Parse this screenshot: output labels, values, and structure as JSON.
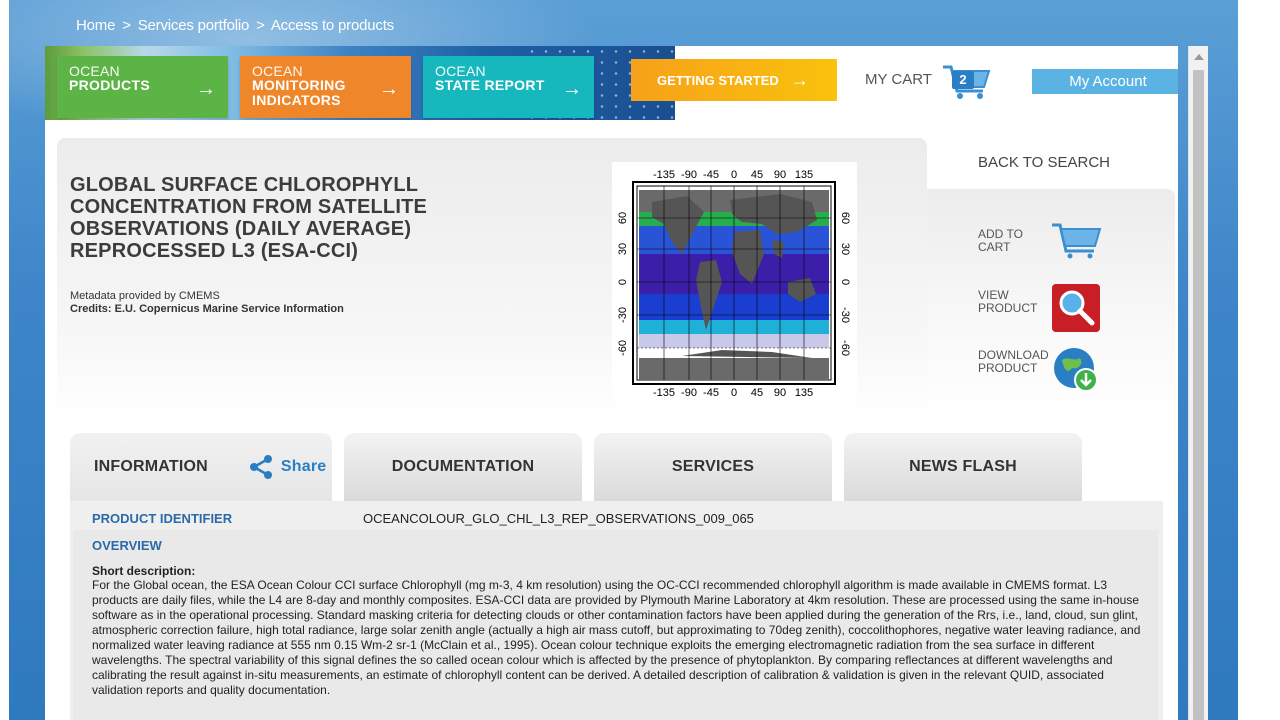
{
  "breadcrumb": {
    "home": "Home",
    "services": "Services portfolio",
    "current": "Access to products",
    "separator": ">"
  },
  "nav": {
    "products": {
      "line1": "OCEAN",
      "line2": "PRODUCTS",
      "arrow": "→"
    },
    "monitoring": {
      "line1": "OCEAN",
      "line2": "MONITORING",
      "line3": "INDICATORS",
      "arrow": "→"
    },
    "state": {
      "line1": "OCEAN",
      "line2": "STATE REPORT",
      "arrow": "→"
    },
    "getting_started": "GETTING STARTED",
    "getting_started_arrow": "→",
    "my_cart": "MY CART",
    "cart_count": "2",
    "my_account": "My Account"
  },
  "product": {
    "title": "GLOBAL SURFACE CHLOROPHYLL CONCENTRATION FROM SATELLITE OBSERVATIONS (DAILY AVERAGE) REPROCESSED L3 (ESA-CCI)",
    "metadata": "Metadata provided by CMEMS",
    "credits": "Credits: E.U. Copernicus Marine Service Information"
  },
  "map": {
    "top_ticks": [
      "-135",
      "-90",
      "-45",
      "0",
      "45",
      "90",
      "135"
    ],
    "bottom_ticks": [
      "-135",
      "-90",
      "-45",
      "0",
      "45",
      "90",
      "135"
    ],
    "left_ticks": [
      "60",
      "30",
      "0",
      "-30",
      "-60"
    ],
    "right_ticks": [
      "60",
      "30",
      "0",
      "-30",
      "-60"
    ]
  },
  "side": {
    "back_to_search": "BACK TO SEARCH",
    "add_to_cart": [
      "ADD TO",
      "CART"
    ],
    "view_product": [
      "VIEW",
      "PRODUCT"
    ],
    "download_product": [
      "DOWNLOAD",
      "PRODUCT"
    ]
  },
  "tabs": {
    "information": "INFORMATION",
    "share": "Share",
    "documentation": "DOCUMENTATION",
    "services": "SERVICES",
    "news_flash": "NEWS FLASH"
  },
  "info": {
    "product_identifier_label": "PRODUCT IDENTIFIER",
    "product_identifier_value": "OCEANCOLOUR_GLO_CHL_L3_REP_OBSERVATIONS_009_065",
    "overview_label": "OVERVIEW",
    "short_description_label": "Short description:",
    "short_description": "For the Global ocean, the ESA Ocean Colour CCI surface Chlorophyll (mg m-3, 4 km resolution) using the OC-CCI recommended chlorophyll algorithm is made available in CMEMS format. L3 products are daily files, while the L4 are 8-day and monthly composites. ESA-CCI data are provided by Plymouth Marine Laboratory at 4km resolution. These are processed using the same in-house software as in the operational processing. Standard masking criteria for detecting clouds or other contamination factors have been applied during the generation of the Rrs, i.e., land, cloud, sun glint, atmospheric correction failure, high total radiance, large solar zenith angle (actually a high air mass cutoff, but approximating to 70deg zenith), coccolithophores, negative water leaving radiance, and normalized water leaving radiance at 555 nm 0.15 Wm-2 sr-1 (McClain et al., 1995). Ocean colour technique exploits the emerging electromagnetic radiation from the sea surface in different wavelengths. The spectral variability of this signal defines the so called ocean colour which is affected by the presence of phytoplankton. By comparing reflectances at different wavelengths and calibrating the result against in-situ measurements, an estimate of chlorophyll content can be derived. A detailed description of calibration & validation is given in the relevant QUID, associated validation reports and quality documentation."
  },
  "colors": {
    "products": "#5db446",
    "monitoring": "#f0862a",
    "state": "#17b8bd",
    "getting_started": "#f7a11a",
    "my_account": "#5bb3e3",
    "label_blue": "#2a6aa8"
  },
  "icons": {
    "cart": "shopping-cart-icon",
    "view": "magnifier-icon",
    "download": "globe-download-icon",
    "share": "share-icon"
  }
}
